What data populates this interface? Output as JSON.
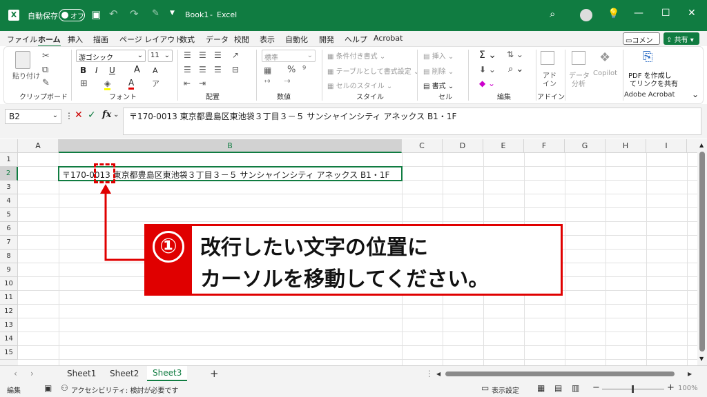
{
  "title_bar": {
    "autosave_label": "自動保存",
    "autosave_state": "オフ",
    "file_name": "Book1",
    "separator": "-",
    "app_name": "Excel"
  },
  "menu": {
    "items": [
      "ファイル",
      "ホーム",
      "挿入",
      "描画",
      "ページ レイアウト",
      "数式",
      "データ",
      "校閲",
      "表示",
      "自動化",
      "開発",
      "ヘルプ",
      "Acrobat"
    ],
    "active": "ホーム",
    "comment_btn": "コメント",
    "share_btn": "共有"
  },
  "ribbon": {
    "groups": [
      "クリップボード",
      "フォント",
      "配置",
      "数値",
      "スタイル",
      "セル",
      "編集",
      "アドイン",
      "Adobe Acrobat"
    ],
    "paste": "貼り付け",
    "font_name": "游ゴシック",
    "font_size": "11",
    "number_format": "標準",
    "cond_format": "条件付き書式",
    "table_format": "テーブルとして書式設定",
    "cell_style": "セルのスタイル",
    "insert": "挿入",
    "delete": "削除",
    "format": "書式",
    "addin_label_1": "アド",
    "addin_label_2": "イン",
    "data_analysis_1": "データ",
    "data_analysis_2": "分析",
    "copilot": "Copilot",
    "pdf_label_1": "PDF を作成し",
    "pdf_label_2": "てリンクを共有",
    "bold": "B",
    "italic": "I",
    "underline": "U",
    "font_grow": "A",
    "font_shrink": "A"
  },
  "formula_bar": {
    "name_box": "B2",
    "fx": "fx",
    "content": "〒170-0013 東京都豊島区東池袋３丁目３－５ サンシャインシティ アネックス B1・1F"
  },
  "grid": {
    "columns": [
      "A",
      "B",
      "C",
      "D",
      "E",
      "F",
      "G",
      "H",
      "I"
    ],
    "rows": [
      "1",
      "2",
      "3",
      "4",
      "5",
      "6",
      "7",
      "8",
      "9",
      "10",
      "11",
      "12",
      "13",
      "14",
      "15"
    ],
    "cell_b2": "〒170-0013 東京都豊島区東池袋３丁目３－５ サンシャインシティ アネックス B1・1F"
  },
  "sheets": {
    "tabs": [
      "Sheet1",
      "Sheet2",
      "Sheet3"
    ],
    "active": "Sheet3",
    "add": "+"
  },
  "status_bar": {
    "mode": "編集",
    "accessibility": "アクセシビリティ: 検討が必要です",
    "display_settings": "表示設定",
    "zoom": "100%"
  },
  "callout": {
    "number": "①",
    "line1": "改行したい文字の位置に",
    "line2": "カーソルを移動してください。"
  },
  "colors": {
    "excel_green": "#107c41",
    "annotation_red": "#e00000"
  }
}
